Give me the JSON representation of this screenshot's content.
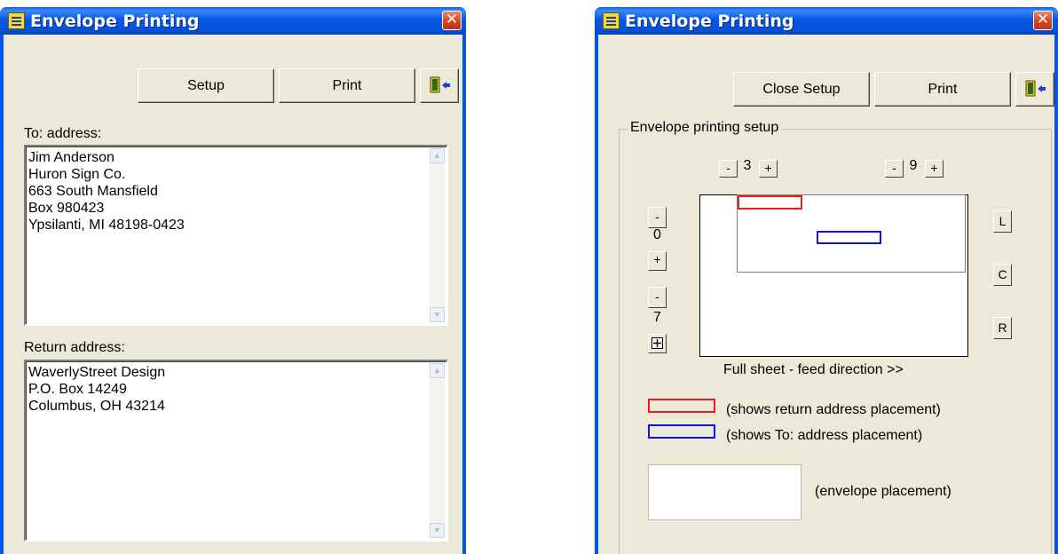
{
  "left_window": {
    "title": "Envelope Printing",
    "setup_button": "Setup",
    "print_button": "Print",
    "to_label": "To: address:",
    "to_address": "Jim Anderson\nHuron Sign Co.\n663 South Mansfield\nBox 980423\nYpsilanti, MI 48198-0423",
    "return_label": "Return address:",
    "return_address": "WaverlyStreet Design\nP.O. Box 14249\nColumbus, OH 43214"
  },
  "right_window": {
    "title": "Envelope Printing",
    "close_setup_button": "Close Setup",
    "print_button": "Print",
    "group_title": "Envelope printing setup",
    "minus": "-",
    "plus": "+",
    "top_left_value": "3",
    "top_right_value": "9",
    "side_top_value": "0",
    "side_bottom_value": "7",
    "align_left": "L",
    "align_center": "C",
    "align_right": "R",
    "feed_caption": "Full sheet - feed direction >>",
    "legend_return": "(shows return address placement)",
    "legend_to": "(shows To: address placement)",
    "legend_envelope": "(envelope placement)"
  },
  "colors": {
    "return_outline": "#e02020",
    "to_outline": "#1010e0"
  }
}
